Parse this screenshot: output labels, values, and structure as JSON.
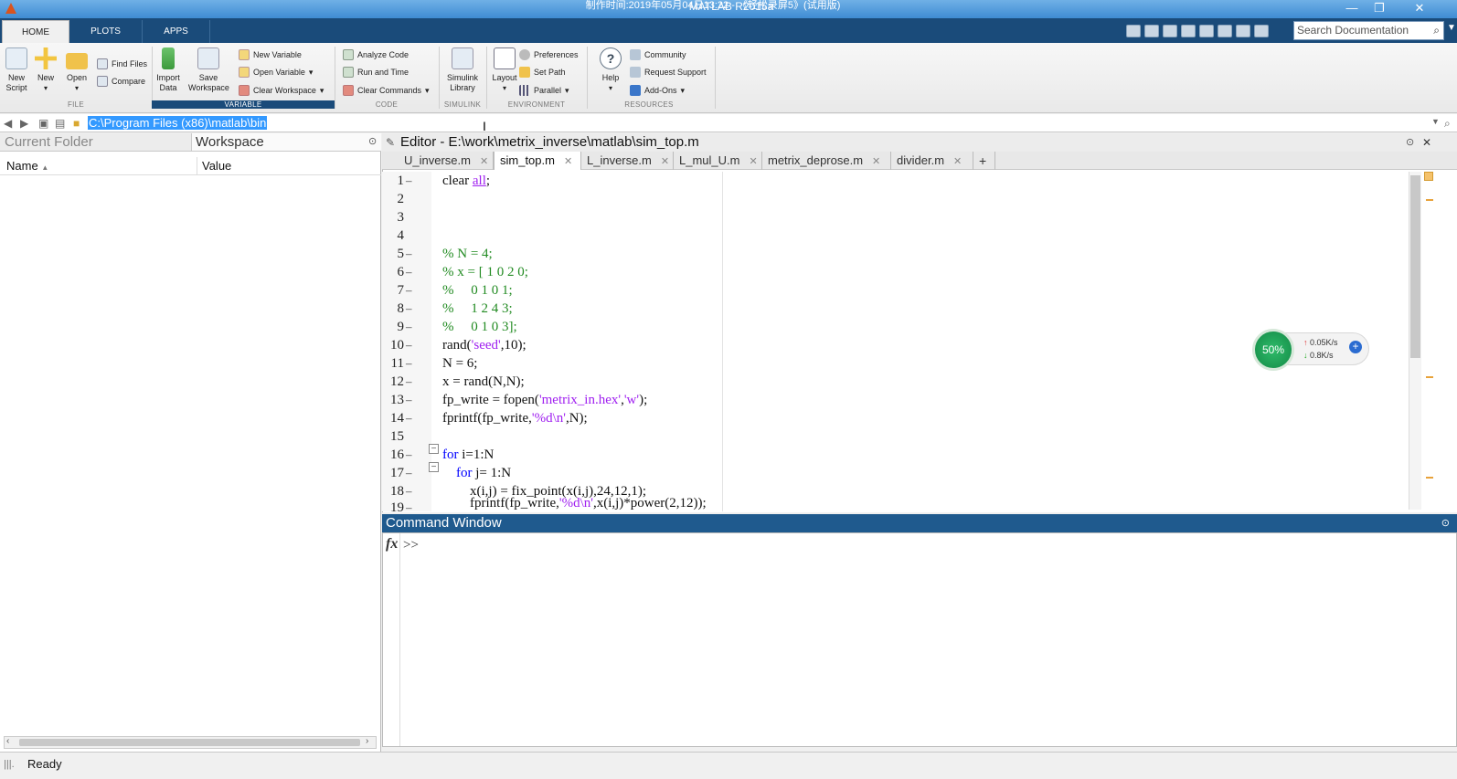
{
  "window": {
    "title": "MATLAB R2015a",
    "overlay_text": "制作时间:2019年05月04日13:22 - 《轻松录屏5》(试用版)"
  },
  "toolstrip_tabs": [
    "HOME",
    "PLOTS",
    "APPS"
  ],
  "search": {
    "placeholder": "Search Documentation"
  },
  "ribbon": {
    "file": {
      "new_script": "New\nScript",
      "new": "New",
      "open": "Open",
      "find_files": "Find Files",
      "compare": "Compare",
      "group": "FILE"
    },
    "variable": {
      "import_data": "Import\nData",
      "save_workspace": "Save\nWorkspace",
      "new_variable": "New Variable",
      "open_variable": "Open Variable",
      "clear_workspace": "Clear Workspace",
      "group": "VARIABLE"
    },
    "code": {
      "analyze_code": "Analyze Code",
      "run_and_time": "Run and Time",
      "clear_commands": "Clear Commands",
      "group": "CODE"
    },
    "simulink": {
      "library": "Simulink\nLibrary",
      "group": "SIMULINK"
    },
    "environment": {
      "layout": "Layout",
      "preferences": "Preferences",
      "set_path": "Set Path",
      "parallel": "Parallel",
      "group": "ENVIRONMENT"
    },
    "resources": {
      "help": "Help",
      "community": "Community",
      "request_support": "Request Support",
      "add_ons": "Add-Ons",
      "group": "RESOURCES"
    }
  },
  "address": {
    "path": "C:\\Program Files (x86)\\matlab\\bin"
  },
  "left_pane": {
    "tab_current_folder": "Current Folder",
    "tab_workspace": "Workspace",
    "col_name": "Name",
    "col_value": "Value"
  },
  "editor": {
    "title": "Editor - E:\\work\\metrix_inverse\\matlab\\sim_top.m",
    "tabs": [
      "U_inverse.m",
      "sim_top.m",
      "L_inverse.m",
      "L_mul_U.m",
      "metrix_deprose.m",
      "divider.m"
    ],
    "active_tab": "sim_top.m",
    "line_numbers": [
      "1",
      "2",
      "3",
      "4",
      "5",
      "6",
      "7",
      "8",
      "9",
      "10",
      "11",
      "12",
      "13",
      "14",
      "15",
      "16",
      "17",
      "18",
      "19"
    ]
  },
  "command_window": {
    "title": "Command Window",
    "prompt": ">>",
    "fx": "fx"
  },
  "status": {
    "text": "Ready"
  },
  "net_widget": {
    "percent": "50%",
    "up": "0.05K/s",
    "down": "0.8K/s"
  }
}
